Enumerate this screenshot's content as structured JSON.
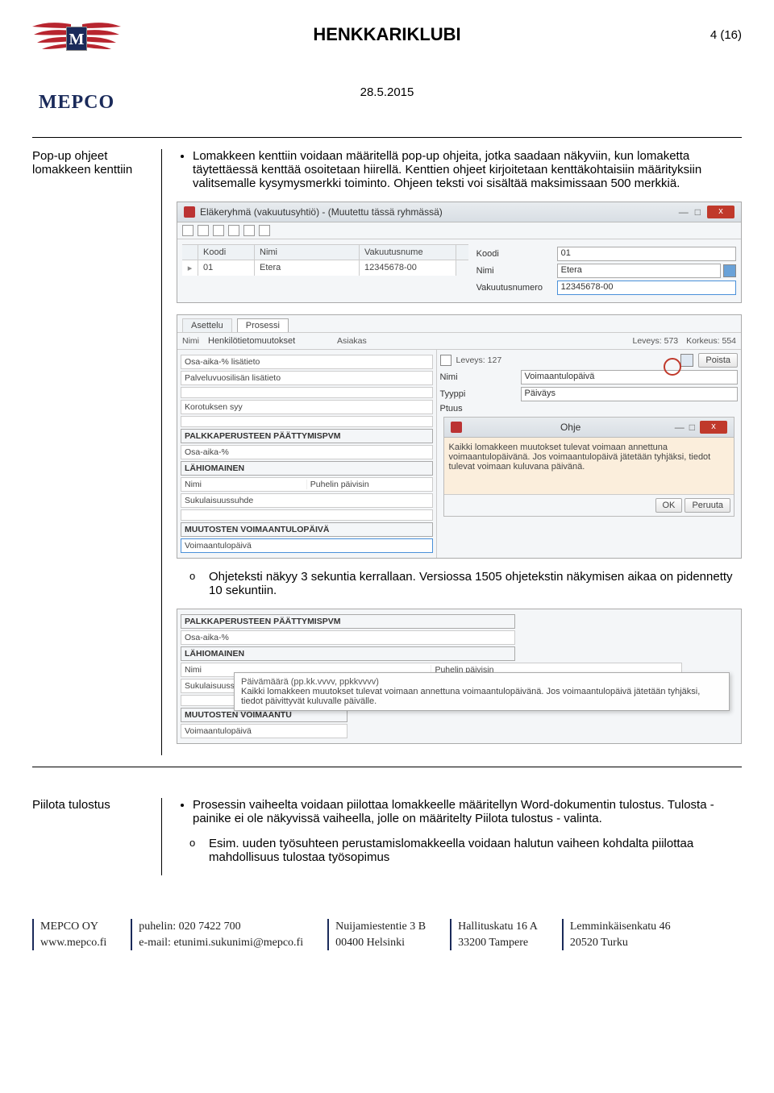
{
  "header": {
    "logo_text": "MEPCO",
    "title": "HENKKARIKLUBI",
    "page_indicator": "4 (16)",
    "date": "28.5.2015"
  },
  "row1": {
    "label": "Pop-up ohjeet lomakkeen kenttiin",
    "bullet": "Lomakkeen kenttiin voidaan määritellä pop-up ohjeita, jotka saadaan näkyviin, kun lomaketta täytettäessä kenttää osoitetaan hiirellä. Kenttien ohjeet kirjoitetaan kenttäkohtaisiin määrityksiin valitsemalle kysymysmerkki toiminto. Ohjeen teksti voi sisältää maksimissaan 500 merkkiä.",
    "sub1": "Ohjeteksti näkyy 3 sekuntia kerrallaan. Versiossa 1505 ohjetekstin näkymisen aikaa on pidennetty 10 sekuntiin."
  },
  "row2": {
    "label": "Piilota tulostus",
    "bullet": "Prosessin vaiheelta voidaan piilottaa lomakkeelle määritellyn Word-dokumentin tulostus. Tulosta -painike ei ole näkyvissä vaiheella, jolle on määritelty Piilota tulostus - valinta.",
    "sub1": "Esim. uuden työsuhteen perustamislomakkeella voidaan halutun vaiheen kohdalta piilottaa mahdollisuus tulostaa työsopimus"
  },
  "ss1": {
    "win_title": "Eläkeryhmä (vakuutusyhtiö) - (Muutettu tässä ryhmässä)",
    "th_koodi": "Koodi",
    "th_nimi": "Nimi",
    "th_vak": "Vakuutusnume",
    "td_koodi": "01",
    "td_nimi": "Etera",
    "td_vak": "12345678-00",
    "f_koodi_l": "Koodi",
    "f_koodi_v": "01",
    "f_nimi_l": "Nimi",
    "f_nimi_v": "Etera",
    "f_vak_l": "Vakuutusnumero",
    "f_vak_v": "12345678-00"
  },
  "ss2": {
    "tab1": "Asettelu",
    "tab2": "Prosessi",
    "l_nimi": "Nimi",
    "v_nimi": "Henkilötietomuutokset",
    "l_asiakas": "Asiakas",
    "dim_leveys": "Leveys: 573",
    "dim_korkeus": "Korkeus: 554",
    "left_items": [
      "Osa-aika-% lisätieto",
      "Palveluvuosilisän lisätieto",
      "",
      "Korotuksen syy",
      "",
      "PALKKAPERUSTEEN PÄÄTTYMISPVM",
      "Osa-aika-%",
      "LÄHIOMAINEN",
      "Nimi",
      "Sukulaisuussuhde",
      "",
      "MUUTOSTEN VOIMAANTULOPÄIVÄ",
      "Voimaantulopäivä"
    ],
    "left_mid_label": "Puhelin päivisin",
    "r_leveys": "Leveys: 127",
    "r_poista": "Poista",
    "r_nimi_l": "Nimi",
    "r_nimi_v": "Voimaantulopäivä",
    "r_tyyppi_l": "Tyyppi",
    "r_tyyppi_v": "Päiväys",
    "r_ptuus_l": "Ptuus",
    "ohje_title": "Ohje",
    "ohje_text": "Kaikki lomakkeen muutokset tulevat voimaan annettuna voimaantulopäivänä. Jos voimaantulopäivä jätetään tyhjäksi, tiedot tulevat voimaan kuluvana päivänä.",
    "btn_ok": "OK",
    "btn_cancel": "Peruuta"
  },
  "ss3": {
    "items": [
      "PALKKAPERUSTEEN PÄÄTTYMISPVM",
      "Osa-aika-%",
      "LÄHIOMAINEN",
      "Nimi",
      "Sukulaisuussuhde",
      "",
      "MUUTOSTEN VOIMAANTU",
      "Voimaantulopäivä"
    ],
    "mid_label": "Puhelin päivisin",
    "tooltip_title": "Päivämäärä (pp.kk.vvvv, ppkkvvvv)",
    "tooltip_body": "Kaikki lomakkeen muutokset tulevat voimaan annettuna voimaantulopäivänä. Jos voimaantulopäivä jätetään tyhjäksi, tiedot päivittyvät kuluvalle päivälle."
  },
  "footer": {
    "c1a": "MEPCO OY",
    "c1b": "www.mepco.fi",
    "c2a": "puhelin: 020 7422 700",
    "c2b": "e-mail: etunimi.sukunimi@mepco.fi",
    "c3a": "Nuijamiestentie 3 B",
    "c3b": "00400 Helsinki",
    "c4a": "Hallituskatu 16 A",
    "c4b": "33200 Tampere",
    "c5a": "Lemminkäisenkatu 46",
    "c5b": "20520 Turku"
  }
}
